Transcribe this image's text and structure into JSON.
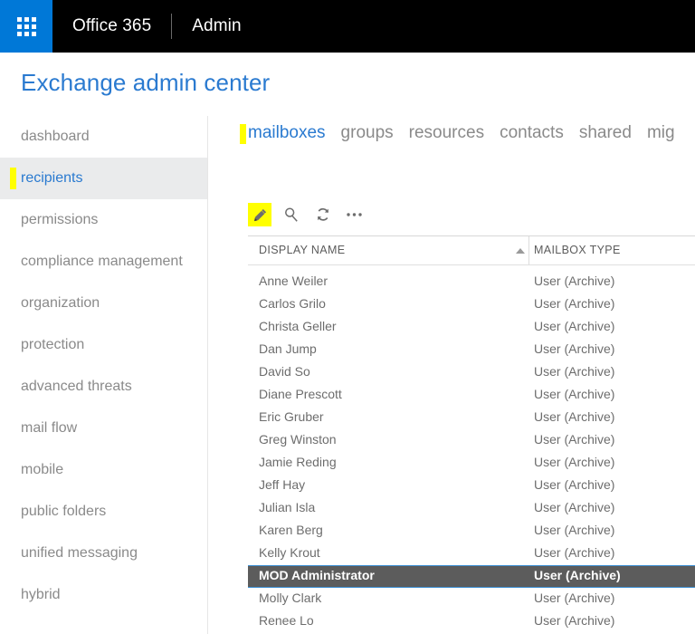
{
  "suite_bar": {
    "waffle_icon": "app-launcher-waffle-icon",
    "brand": "Office 365",
    "app": "Admin"
  },
  "page_title": "Exchange admin center",
  "sidebar": {
    "items": [
      {
        "label": "dashboard",
        "selected": false
      },
      {
        "label": "recipients",
        "selected": true
      },
      {
        "label": "permissions",
        "selected": false
      },
      {
        "label": "compliance management",
        "selected": false
      },
      {
        "label": "organization",
        "selected": false
      },
      {
        "label": "protection",
        "selected": false
      },
      {
        "label": "advanced threats",
        "selected": false
      },
      {
        "label": "mail flow",
        "selected": false
      },
      {
        "label": "mobile",
        "selected": false
      },
      {
        "label": "public folders",
        "selected": false
      },
      {
        "label": "unified messaging",
        "selected": false
      },
      {
        "label": "hybrid",
        "selected": false
      }
    ]
  },
  "tabs": [
    {
      "label": "mailboxes",
      "active": true
    },
    {
      "label": "groups",
      "active": false
    },
    {
      "label": "resources",
      "active": false
    },
    {
      "label": "contacts",
      "active": false
    },
    {
      "label": "shared",
      "active": false
    },
    {
      "label": "mig",
      "active": false
    }
  ],
  "toolbar": [
    {
      "icon": "pencil-edit-icon",
      "highlighted": true
    },
    {
      "icon": "search-magnifier-icon",
      "highlighted": false
    },
    {
      "icon": "refresh-icon",
      "highlighted": false
    },
    {
      "icon": "more-ellipsis-icon",
      "highlighted": false
    }
  ],
  "table": {
    "columns": [
      {
        "label": "DISPLAY NAME",
        "sort": "ascending"
      },
      {
        "label": "MAILBOX TYPE",
        "sort": null
      }
    ],
    "rows": [
      {
        "display_name": "Anne Weiler",
        "mailbox_type": "User (Archive)",
        "selected": false
      },
      {
        "display_name": "Carlos Grilo",
        "mailbox_type": "User (Archive)",
        "selected": false
      },
      {
        "display_name": "Christa Geller",
        "mailbox_type": "User (Archive)",
        "selected": false
      },
      {
        "display_name": "Dan Jump",
        "mailbox_type": "User (Archive)",
        "selected": false
      },
      {
        "display_name": "David So",
        "mailbox_type": "User (Archive)",
        "selected": false
      },
      {
        "display_name": "Diane Prescott",
        "mailbox_type": "User (Archive)",
        "selected": false
      },
      {
        "display_name": "Eric Gruber",
        "mailbox_type": "User (Archive)",
        "selected": false
      },
      {
        "display_name": "Greg Winston",
        "mailbox_type": "User (Archive)",
        "selected": false
      },
      {
        "display_name": "Jamie Reding",
        "mailbox_type": "User (Archive)",
        "selected": false
      },
      {
        "display_name": "Jeff Hay",
        "mailbox_type": "User (Archive)",
        "selected": false
      },
      {
        "display_name": "Julian Isla",
        "mailbox_type": "User (Archive)",
        "selected": false
      },
      {
        "display_name": "Karen Berg",
        "mailbox_type": "User (Archive)",
        "selected": false
      },
      {
        "display_name": "Kelly Krout",
        "mailbox_type": "User (Archive)",
        "selected": false
      },
      {
        "display_name": "MOD Administrator",
        "mailbox_type": "User (Archive)",
        "selected": true
      },
      {
        "display_name": "Molly Clark",
        "mailbox_type": "User (Archive)",
        "selected": false
      },
      {
        "display_name": "Renee Lo",
        "mailbox_type": "User (Archive)",
        "selected": false
      }
    ]
  },
  "colors": {
    "suite_bar_bg": "#000000",
    "waffle_bg": "#0078d7",
    "accent_blue": "#2a7ad0",
    "highlight_yellow": "#ffff00",
    "nav_selected_bg": "#eaebec",
    "row_selected_bg": "#5c5c5c",
    "row_selected_border": "#3c8fd4"
  }
}
